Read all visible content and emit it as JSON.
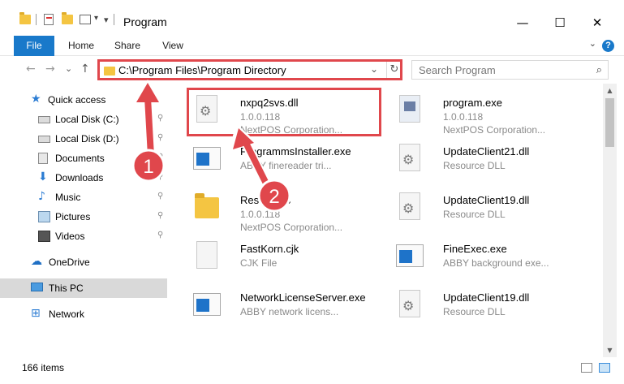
{
  "window": {
    "title": "Program",
    "minimize_glyph": "—",
    "maximize_glyph": "☐",
    "close_glyph": "✕"
  },
  "ribbon": {
    "tabs": [
      "File",
      "Home",
      "Share",
      "View"
    ],
    "help_glyph": "?",
    "expand_glyph": "⌄"
  },
  "address": {
    "path": "C:\\Program Files\\Program Directory",
    "dropdown_glyph": "⌄",
    "refresh_glyph": "↻"
  },
  "search": {
    "placeholder": "Search Program",
    "icon": "search-icon",
    "icon_glyph": "⌕"
  },
  "nav_buttons": {
    "back_glyph": "←",
    "forward_glyph": "→",
    "recent_glyph": "⌄",
    "up_glyph": "↑"
  },
  "navpane": {
    "items": [
      {
        "label": "Quick access",
        "icon": "star-icon",
        "pinned": false,
        "selected": false
      },
      {
        "label": "Local Disk (C:)",
        "icon": "drive-icon",
        "pinned": true,
        "selected": false
      },
      {
        "label": "Local Disk (D:)",
        "icon": "drive-icon",
        "pinned": true,
        "selected": false
      },
      {
        "label": "Documents",
        "icon": "documents-icon",
        "pinned": true,
        "selected": false
      },
      {
        "label": "Downloads",
        "icon": "downloads-icon",
        "pinned": true,
        "selected": false
      },
      {
        "label": "Music",
        "icon": "music-icon",
        "pinned": true,
        "selected": false
      },
      {
        "label": "Pictures",
        "icon": "pictures-icon",
        "pinned": true,
        "selected": false
      },
      {
        "label": "Videos",
        "icon": "videos-icon",
        "pinned": true,
        "selected": false
      },
      {
        "label": "OneDrive",
        "icon": "cloud-icon",
        "pinned": false,
        "selected": false
      },
      {
        "label": "This PC",
        "icon": "computer-icon",
        "pinned": false,
        "selected": true
      },
      {
        "label": "Network",
        "icon": "network-icon",
        "pinned": false,
        "selected": false
      }
    ],
    "pin_glyph": "📌"
  },
  "files": [
    {
      "name": "nxpq2svs.dll",
      "sub1": "1.0.0.118",
      "sub2": "NextPOS Corporation...",
      "icon": "dll-file-icon",
      "highlighted": true
    },
    {
      "name": "program.exe",
      "sub1": "1.0.0.118",
      "sub2": "NextPOS Corporation...",
      "icon": "exe-file-icon",
      "highlighted": false
    },
    {
      "name": "ProgrammsInstaller.exe",
      "sub1": "ABBY finereader tri...",
      "sub2": "",
      "icon": "app-window-icon",
      "highlighted": false
    },
    {
      "name": "UpdateClient21.dll",
      "sub1": "Resource DLL",
      "sub2": "",
      "icon": "dll-file-icon",
      "highlighted": false
    },
    {
      "name": "Resources",
      "sub1": "1.0.0.118",
      "sub2": "NextPOS Corporation...",
      "icon": "folder-icon",
      "highlighted": false
    },
    {
      "name": "UpdateClient19.dll",
      "sub1": "Resource DLL",
      "sub2": "",
      "icon": "dll-file-icon",
      "highlighted": false
    },
    {
      "name": "FastKorn.cjk",
      "sub1": "CJK File",
      "sub2": "",
      "icon": "blank-file-icon",
      "highlighted": false
    },
    {
      "name": "FineExec.exe",
      "sub1": "ABBY background exe...",
      "sub2": "",
      "icon": "app-window-icon",
      "highlighted": false
    },
    {
      "name": "NetworkLicenseServer.exe",
      "sub1": "ABBY network licens...",
      "sub2": "",
      "icon": "app-window-icon",
      "highlighted": false
    },
    {
      "name": "UpdateClient19.dll",
      "sub1": "Resource DLL",
      "sub2": "",
      "icon": "dll-file-icon",
      "highlighted": false
    }
  ],
  "annotations": [
    {
      "number": "1",
      "color": "#e0474c"
    },
    {
      "number": "2",
      "color": "#e0474c"
    }
  ],
  "scrollbar": {
    "up_glyph": "▲",
    "down_glyph": "▼"
  },
  "status": {
    "item_count": "166 items"
  },
  "colors": {
    "accent": "#1979ca",
    "highlight": "#e0474c",
    "selected_nav": "#d9d9d9"
  }
}
